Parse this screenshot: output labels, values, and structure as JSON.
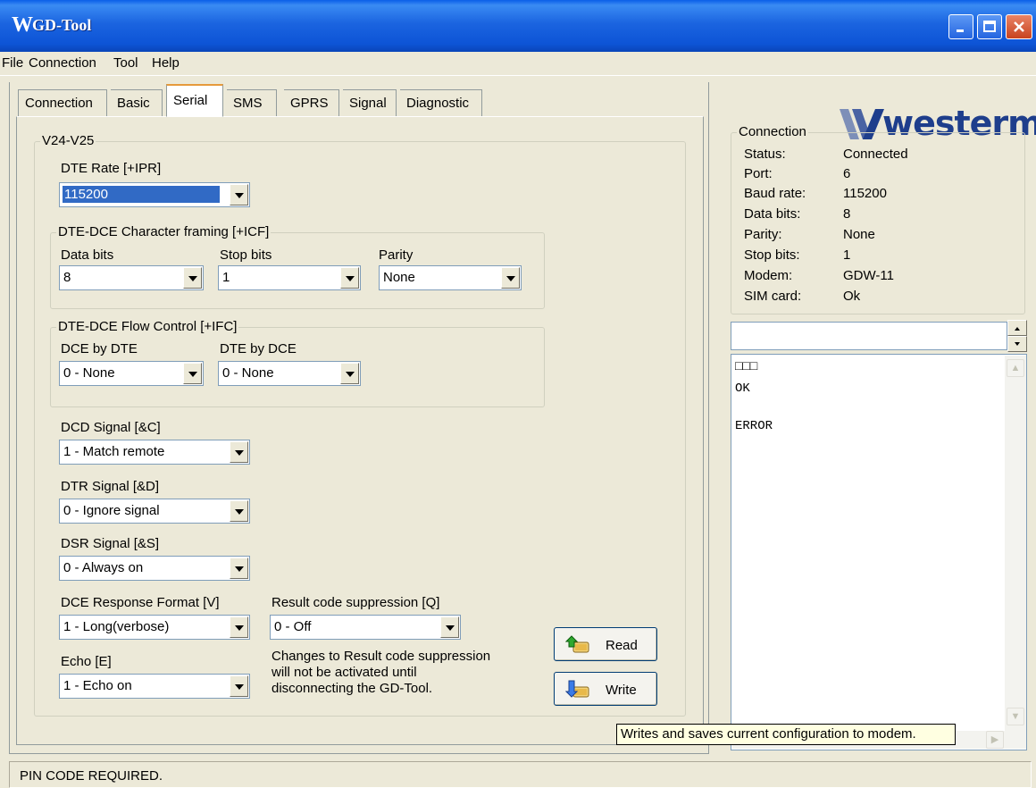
{
  "window": {
    "title": "GD-Tool",
    "logo_glyph": "W"
  },
  "menu": [
    "File",
    "Connection",
    "Tool",
    "Help"
  ],
  "tabs": [
    {
      "label": "Connection",
      "active": false
    },
    {
      "label": "Basic",
      "active": false
    },
    {
      "label": "Serial",
      "active": true
    },
    {
      "label": "SMS",
      "active": false
    },
    {
      "label": "GPRS",
      "active": false
    },
    {
      "label": "Signal",
      "active": false
    },
    {
      "label": "Diagnostic",
      "active": false
    }
  ],
  "serial": {
    "group_title": "V24-V25",
    "dte_rate": {
      "label": "DTE Rate [+IPR]",
      "value": "115200"
    },
    "framing": {
      "group_title": "DTE-DCE Character framing [+ICF]",
      "data_bits": {
        "label": "Data bits",
        "value": "8"
      },
      "stop_bits": {
        "label": "Stop bits",
        "value": "1"
      },
      "parity": {
        "label": "Parity",
        "value": "None"
      }
    },
    "flow": {
      "group_title": "DTE-DCE Flow Control [+IFC]",
      "dce_by_dte": {
        "label": "DCE by DTE",
        "value": "0 - None"
      },
      "dte_by_dce": {
        "label": "DTE by DCE",
        "value": "0 - None"
      }
    },
    "dcd": {
      "label": "DCD Signal [&C]",
      "value": "1 - Match remote"
    },
    "dtr": {
      "label": "DTR Signal [&D]",
      "value": "0 - Ignore signal"
    },
    "dsr": {
      "label": "DSR Signal [&S]",
      "value": "0 - Always on"
    },
    "response_format": {
      "label": "DCE Response Format [V]",
      "value": "1 - Long(verbose)"
    },
    "result_suppression": {
      "label": "Result code suppression [Q]",
      "value": "0 - Off"
    },
    "suppression_note": [
      "Changes to Result code suppression",
      "will not be activated until",
      "disconnecting the GD-Tool."
    ],
    "echo": {
      "label": "Echo [E]",
      "value": "1 - Echo on"
    },
    "read_button": "Read",
    "write_button": "Write"
  },
  "brand": "westermo",
  "connection": {
    "group_title": "Connection",
    "rows": [
      {
        "key": "Status:",
        "value": "Connected"
      },
      {
        "key": "Port:",
        "value": "6"
      },
      {
        "key": "Baud rate:",
        "value": "115200"
      },
      {
        "key": "Data bits:",
        "value": "8"
      },
      {
        "key": "Parity:",
        "value": "None"
      },
      {
        "key": "Stop bits:",
        "value": "1"
      },
      {
        "key": "Modem:",
        "value": "GDW-11"
      },
      {
        "key": "SIM card:",
        "value": "Ok"
      }
    ]
  },
  "command_input": {
    "value": ""
  },
  "terminal_lines": [
    "□□□",
    "OK",
    "",
    "ERROR"
  ],
  "tooltip": "Writes and saves current configuration to modem.",
  "status": "PIN CODE REQUIRED.",
  "colors": {
    "title_blue": "#0d54d6",
    "selection": "#316ac5",
    "tab_highlight": "#e69a3b",
    "brand_blue": "#1e3e8c"
  },
  "icons": [
    "minimize-icon",
    "maximize-icon",
    "close-icon",
    "read-icon",
    "write-icon",
    "scroll-up-icon",
    "scroll-down-icon"
  ]
}
